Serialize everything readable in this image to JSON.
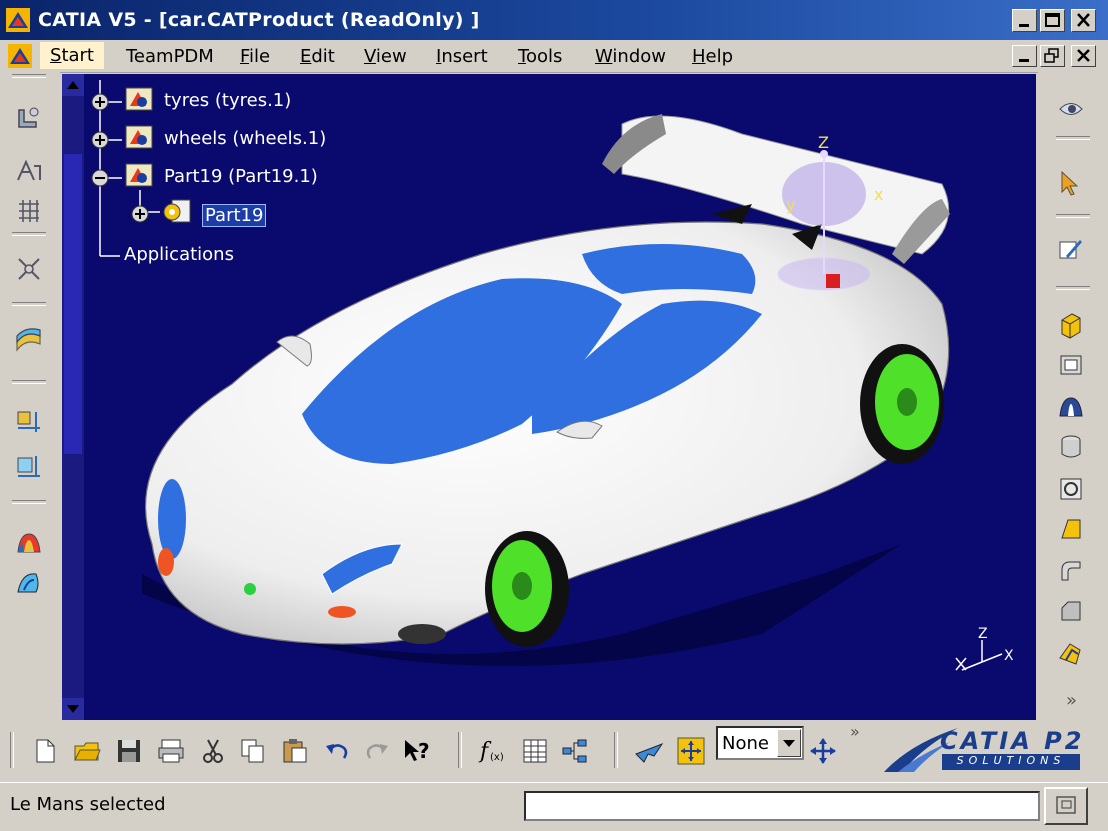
{
  "window": {
    "title": "CATIA V5 - [car.CATProduct (ReadOnly) ]"
  },
  "menu": {
    "items": [
      {
        "label": "Start",
        "ul": "S",
        "rest": "tart"
      },
      {
        "label": "TeamPDM",
        "ul": "",
        "rest": "TeamPDM"
      },
      {
        "label": "File",
        "ul": "F",
        "rest": "ile"
      },
      {
        "label": "Edit",
        "ul": "E",
        "rest": "dit"
      },
      {
        "label": "View",
        "ul": "V",
        "rest": "iew"
      },
      {
        "label": "Insert",
        "ul": "I",
        "rest": "nsert"
      },
      {
        "label": "Tools",
        "ul": "T",
        "rest": "ools"
      },
      {
        "label": "Window",
        "ul": "W",
        "rest": "indow"
      },
      {
        "label": "Help",
        "ul": "H",
        "rest": "elp"
      }
    ]
  },
  "tree": {
    "nodes": [
      {
        "label": "tyres (tyres.1)"
      },
      {
        "label": "wheels (wheels.1)"
      },
      {
        "label": "Part19 (Part19.1)"
      },
      {
        "label": "Part19"
      },
      {
        "label": "Applications"
      }
    ]
  },
  "compass": {
    "z": "Z",
    "x": "x",
    "y": "y"
  },
  "axis_triad": {
    "z": "Z",
    "x": "X"
  },
  "bottom_toolbar": {
    "filter_select_value": "None",
    "more_chevron": "»"
  },
  "right_toolbar": {
    "more_chevron": "»"
  },
  "brand": {
    "name": "CATIA P2",
    "tagline": "SOLUTIONS"
  },
  "status": {
    "message": "Le Mans selected",
    "command_input_value": ""
  },
  "colors": {
    "viewport_bg": "#0a0a6e",
    "car_body": "#f2f2f2",
    "glass": "#2f6fe0",
    "wheels": "#4fe02a",
    "title_bar": "#0a246a"
  }
}
